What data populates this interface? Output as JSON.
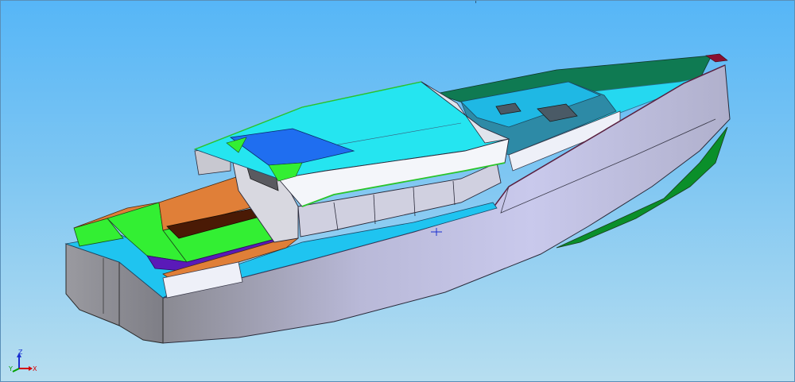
{
  "viewport": {
    "background_top": "#56b6f7",
    "background_bottom": "#b7def0"
  },
  "triad": {
    "x_label": "X",
    "y_label": "Y",
    "z_label": "Z",
    "x_color": "#d40000",
    "y_color": "#00a000",
    "z_color": "#1a2fd0"
  },
  "colors": {
    "hull_side": "#c8c8e6",
    "transom": "#8c8c90",
    "antifouling": "#0a8f2a",
    "deck_teak_green": "#0f7a52",
    "cabin_roof": "#25e5f0",
    "cockpit_floor": "#1fc4f0",
    "cockpit_seat": "#33ef33",
    "cushion": "#e07f38",
    "table_top": "#4a1a05",
    "sole_purple": "#5a1ab8",
    "bimini": "#1f6ef0",
    "foredeck_panel": "#2d8aa6"
  }
}
